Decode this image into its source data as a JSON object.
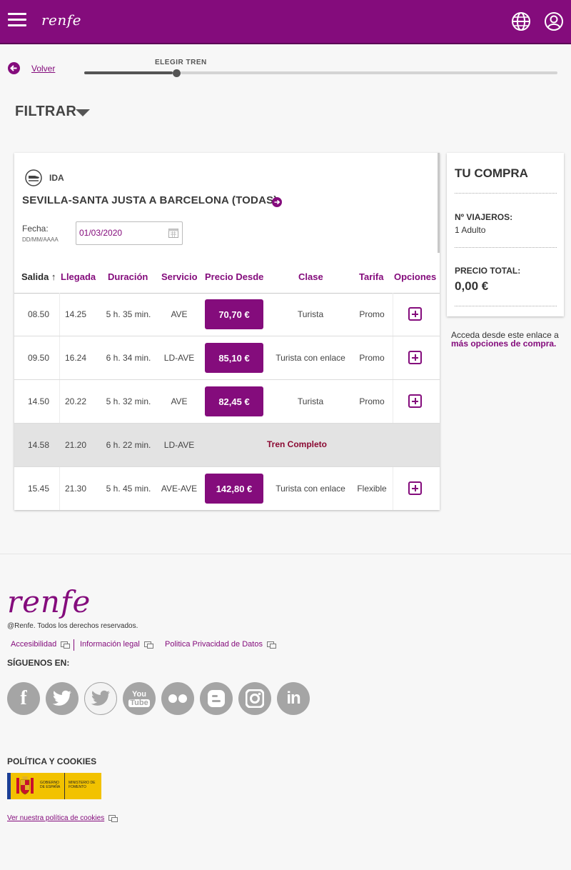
{
  "header": {
    "brand": "renfe",
    "icons": [
      "menu-icon",
      "globe-icon",
      "user-icon"
    ],
    "brand_color": "#840c7c"
  },
  "progress": {
    "back_label": "Volver",
    "step_label": "ELEGIR TREN"
  },
  "filter": {
    "label": "FILTRAR"
  },
  "journey": {
    "direction": "IDA",
    "route": "SEVILLA-SANTA JUSTA A BARCELONA (TODAS)",
    "date_label": "Fecha:",
    "date_format": "DD/MM/AAAA",
    "date_value": "01/03/2020"
  },
  "table": {
    "headers": [
      "Salida",
      "Llegada",
      "Duración",
      "Servicio",
      "Precio Desde",
      "Clase",
      "Tarifa",
      "Opciones"
    ],
    "sort_indicator": "↑",
    "rows": [
      {
        "salida": "08.50",
        "llegada": "14.25",
        "duracion": "5 h. 35 min.",
        "servicio": "AVE",
        "precio": "70,70 €",
        "clase": "Turista",
        "tarifa": "Promo"
      },
      {
        "salida": "09.50",
        "llegada": "16.24",
        "duracion": "6 h. 34 min.",
        "servicio": "LD-AVE",
        "precio": "85,10 €",
        "clase": "Turista con enlace",
        "tarifa": "Promo"
      },
      {
        "salida": "14.50",
        "llegada": "20.22",
        "duracion": "5 h. 32 min.",
        "servicio": "AVE",
        "precio": "82,45 €",
        "clase": "Turista",
        "tarifa": "Promo"
      },
      {
        "salida": "14.58",
        "llegada": "21.20",
        "duracion": "6 h. 22 min.",
        "servicio": "LD-AVE",
        "status": "Tren Completo"
      },
      {
        "salida": "15.45",
        "llegada": "21.30",
        "duracion": "5 h. 45 min.",
        "servicio": "AVE-AVE",
        "precio": "142,80 €",
        "clase": "Turista con enlace",
        "tarifa": "Flexible"
      }
    ]
  },
  "purchase": {
    "title": "TU COMPRA",
    "travelers_label": "Nº VIAJEROS:",
    "travelers_value": "1 Adulto",
    "total_label": "PRECIO TOTAL:",
    "total_value": "0,00 €",
    "more_text": "Acceda desde este enlace a",
    "more_link": "más opciones de compra."
  },
  "footer": {
    "logo": "renfe",
    "copyright": "@Renfe. Todos los derechos reservados.",
    "links": [
      "Accesibilidad",
      "Información legal",
      "Politica Privacidad de Datos"
    ],
    "follow_label": "SÍGUENOS EN:",
    "social": [
      "facebook-icon",
      "twitter-icon",
      "twitter-outline-icon",
      "youtube-icon",
      "flickr-icon",
      "blogger-icon",
      "instagram-icon",
      "linkedin-icon"
    ],
    "cookies_title": "POLÍTICA Y COOKIES",
    "gov_text_1": "GOBIERNO DE ESPAÑA",
    "gov_text_2": "MINISTERIO DE FOMENTO",
    "cookies_link": "Ver nuestra política de cookies"
  }
}
